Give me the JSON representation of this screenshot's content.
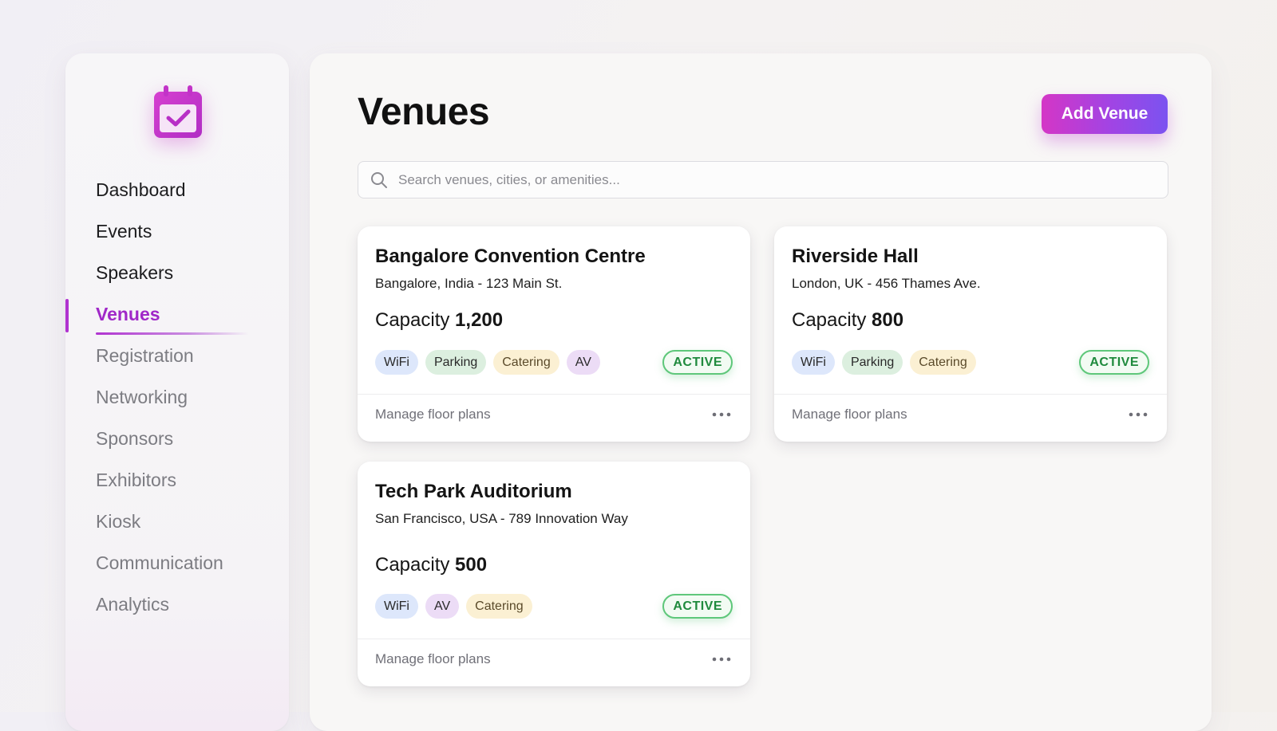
{
  "sidebar": {
    "logo_icon": "calendar-check-icon",
    "items": [
      {
        "label": "Dashboard"
      },
      {
        "label": "Events"
      },
      {
        "label": "Speakers"
      },
      {
        "label": "Venues"
      },
      {
        "label": "Registration"
      },
      {
        "label": "Networking"
      },
      {
        "label": "Sponsors"
      },
      {
        "label": "Exhibitors"
      },
      {
        "label": "Kiosk"
      },
      {
        "label": "Communication"
      },
      {
        "label": "Analytics"
      }
    ],
    "active_item": "Venues"
  },
  "header": {
    "title": "Venues",
    "add_button_label": "Add Venue"
  },
  "search": {
    "placeholder": "Search venues, cities, or amenities..."
  },
  "colors": {
    "accent": "#b033d0",
    "active_status": "#1f8a3d"
  },
  "venues": [
    {
      "name": "Bangalore Convention Centre",
      "address": "Bangalore, India - 123 Main St.",
      "capacity_label": "Capacity",
      "capacity": "1,200",
      "amenities": [
        "WiFi",
        "Parking",
        "Catering",
        "AV"
      ],
      "status": "ACTIVE",
      "footer_link": "Manage floor plans"
    },
    {
      "name": "Riverside Hall",
      "address": "London, UK - 456 Thames Ave.",
      "capacity_label": "Capacity",
      "capacity": "800",
      "amenities": [
        "WiFi",
        "Parking",
        "Catering"
      ],
      "status": "ACTIVE",
      "footer_link": "Manage floor plans"
    },
    {
      "name": "Tech Park Auditorium",
      "address": "San Francisco, USA - 789 Innovation Way",
      "capacity_label": "Capacity",
      "capacity": "500",
      "amenities": [
        "WiFi",
        "AV",
        "Catering"
      ],
      "status": "ACTIVE",
      "footer_link": "Manage floor plans"
    }
  ]
}
